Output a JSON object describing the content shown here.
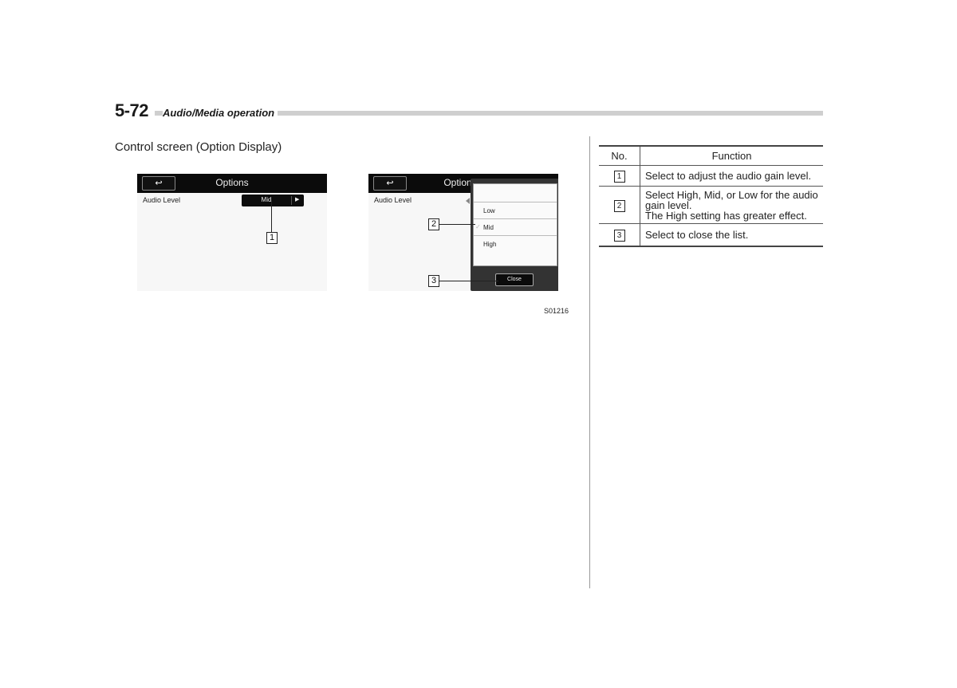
{
  "header": {
    "page_number": "5-72",
    "section_title": "Audio/Media operation"
  },
  "subtitle": "Control screen (Option Display)",
  "screen1": {
    "back_icon": "↩",
    "title": "Options",
    "row_label": "Audio Level",
    "selected_value": "Mid",
    "arrow_icon": "▶",
    "callout": "1"
  },
  "screen2": {
    "back_icon": "↩",
    "title": "Options",
    "row_label": "Audio Level",
    "options": [
      "Low",
      "Mid",
      "High"
    ],
    "selected_option": "Mid",
    "check_icon": "✓",
    "close_label": "Close",
    "callout_list": "2",
    "callout_close": "3"
  },
  "figure_code": "S01216",
  "table": {
    "headers": {
      "no": "No.",
      "function": "Function"
    },
    "rows": [
      {
        "no": "1",
        "lines": [
          "Select to adjust the audio gain level."
        ]
      },
      {
        "no": "2",
        "lines": [
          "Select High, Mid, or Low for the audio",
          "gain level.",
          "The High setting has greater effect."
        ]
      },
      {
        "no": "3",
        "lines": [
          "Select to close the list."
        ]
      }
    ]
  }
}
